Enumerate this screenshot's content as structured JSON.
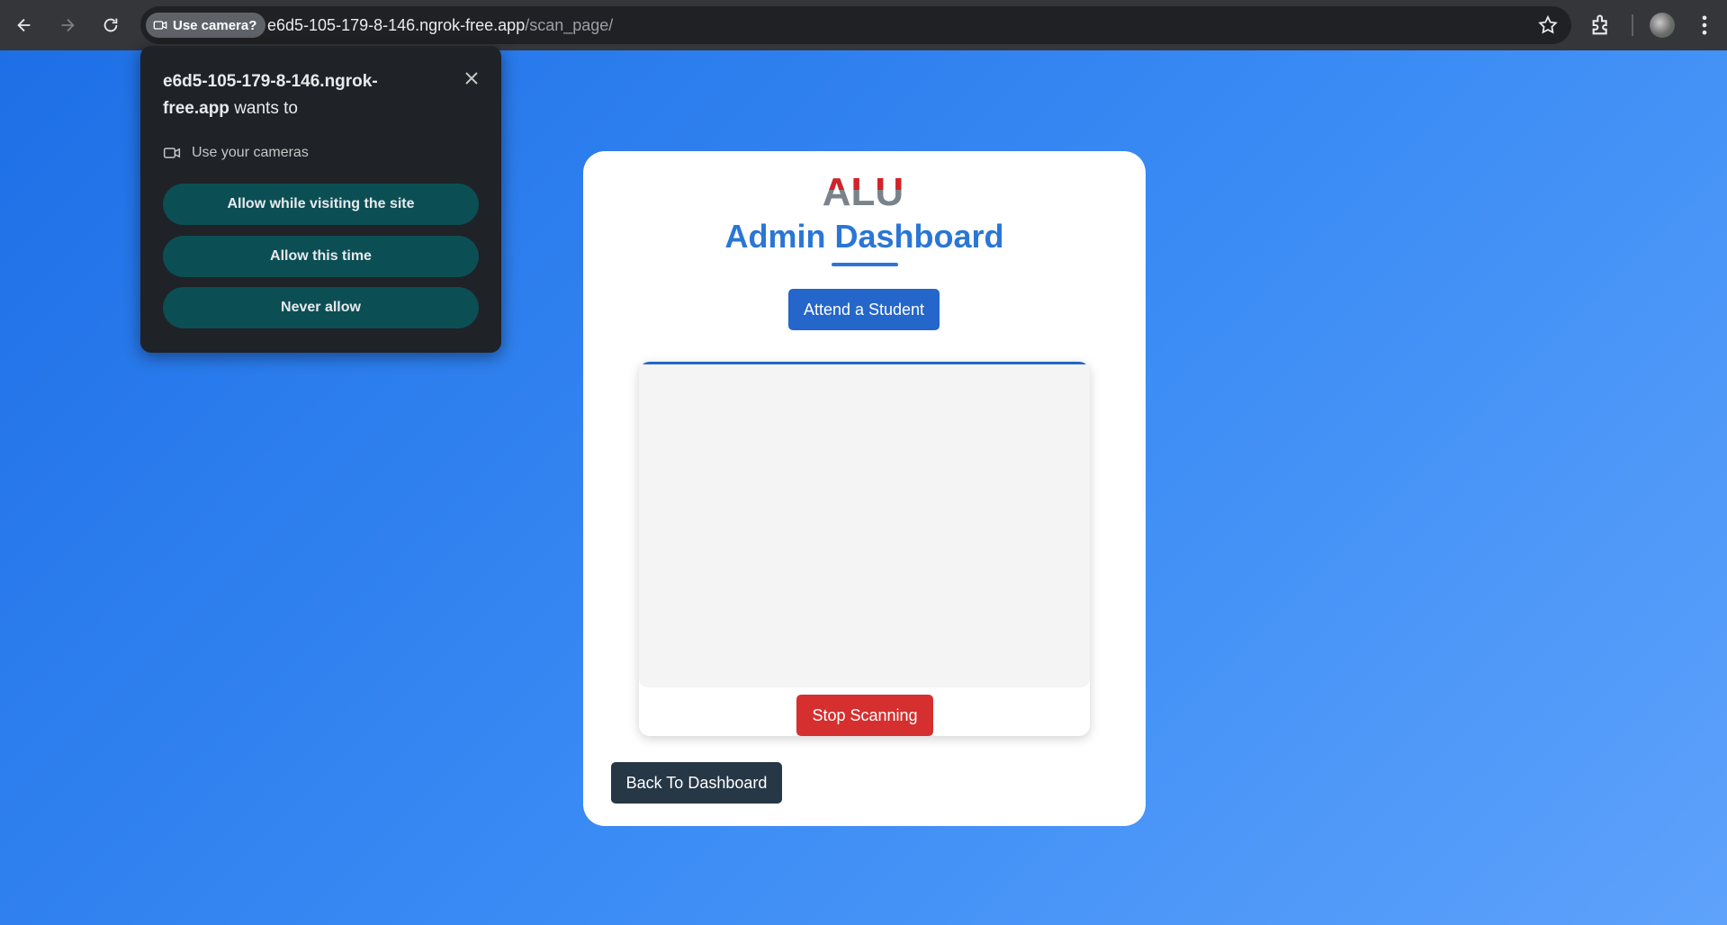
{
  "browser": {
    "camera_chip_label": "Use camera?",
    "url_host": "e6d5-105-179-8-146.ngrok-free.app",
    "url_path": "/scan_page/"
  },
  "permission_popup": {
    "site": "e6d5-105-179-8-146.ngrok-free.app",
    "suffix": " wants to",
    "permission_label": "Use your cameras",
    "buttons": [
      "Allow while visiting the site",
      "Allow this time",
      "Never allow"
    ]
  },
  "card": {
    "logo_text": "ALU",
    "title": "Admin Dashboard",
    "attend_button": "Attend a Student",
    "stop_button": "Stop Scanning",
    "back_button": "Back To Dashboard"
  },
  "colors": {
    "accent": "#2a76d6",
    "stop_red": "#d62f2f",
    "dark_button": "#263746",
    "popup_button": "#0b4f55"
  }
}
